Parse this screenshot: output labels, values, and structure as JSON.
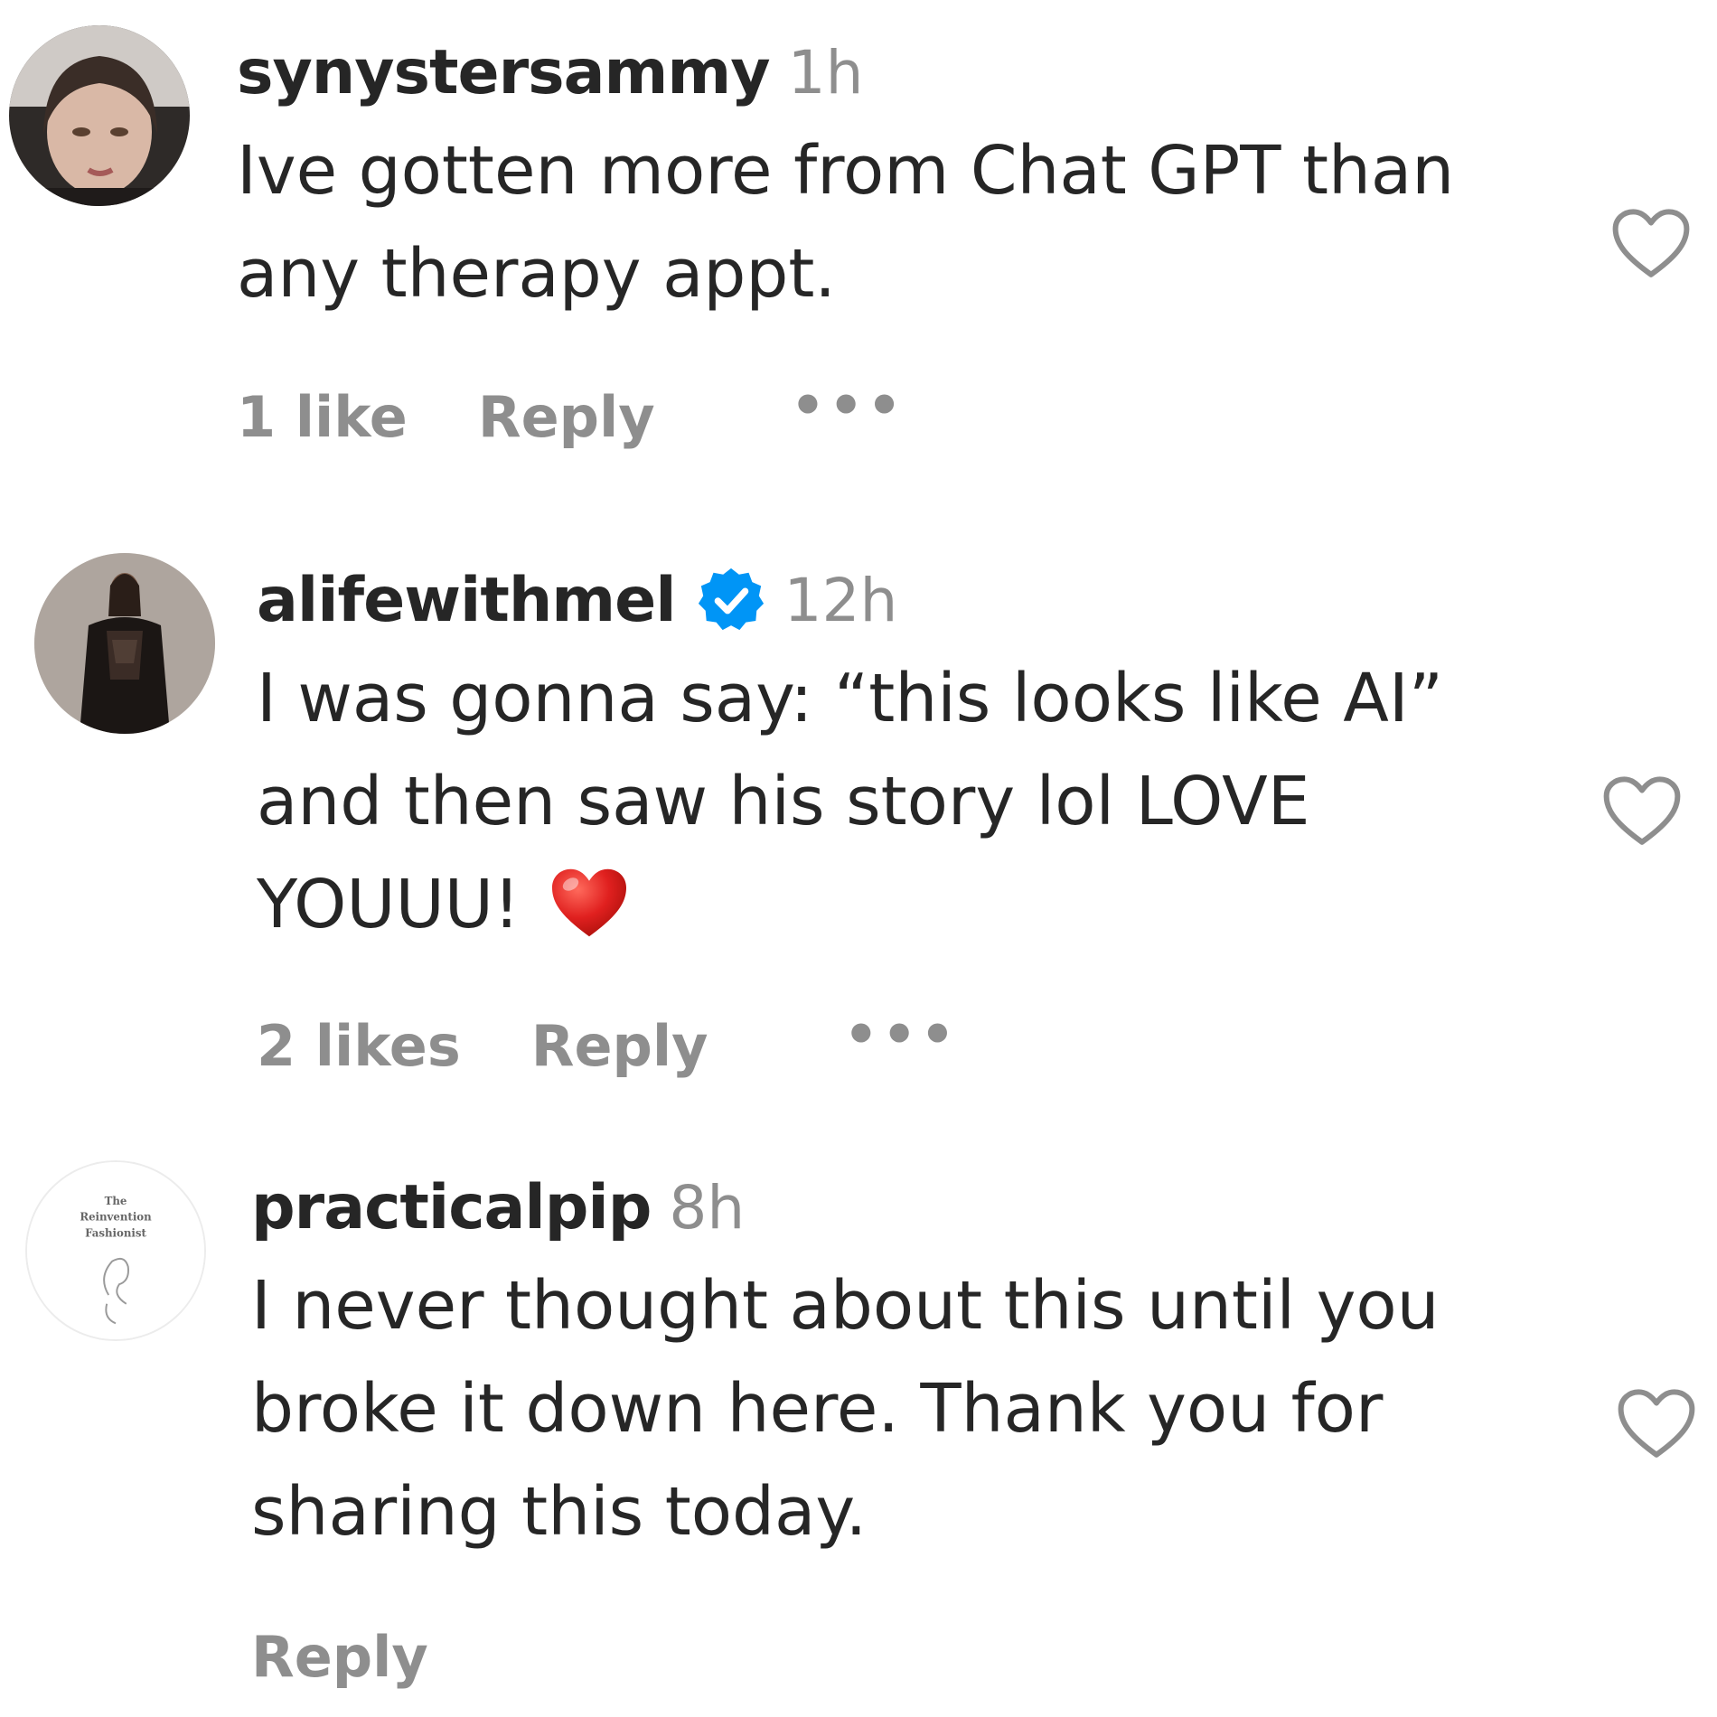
{
  "comments": [
    {
      "username": "synystersammy",
      "verified": false,
      "time": "1h",
      "text_lines": [
        "Ive gotten more from Chat GPT than",
        "any therapy appt."
      ],
      "has_emoji": false,
      "likes": "1 like",
      "reply_label": "Reply",
      "more_label": "•••"
    },
    {
      "username": "alifewithmel",
      "verified": true,
      "time": "12h",
      "text_lines": [
        "I was gonna say: “this looks like AI”",
        "and then saw his story lol LOVE",
        "YOUUU!"
      ],
      "has_emoji": true,
      "emoji": "red-heart",
      "likes": "2 likes",
      "reply_label": "Reply",
      "more_label": "•••"
    },
    {
      "username": "practicalpip",
      "verified": false,
      "time": "8h",
      "text_lines": [
        "I never thought about this until you",
        "broke it down here. Thank you for",
        "sharing this today."
      ],
      "has_emoji": false,
      "likes": "",
      "reply_label": "Reply",
      "more_label": "",
      "avatar_logo_lines": [
        "The",
        "Reinvention",
        "Fashionist"
      ]
    }
  ],
  "colors": {
    "text": "#262626",
    "muted": "#8e8e8e",
    "verified": "#0095f6",
    "emoji_heart": "#e0201f"
  }
}
